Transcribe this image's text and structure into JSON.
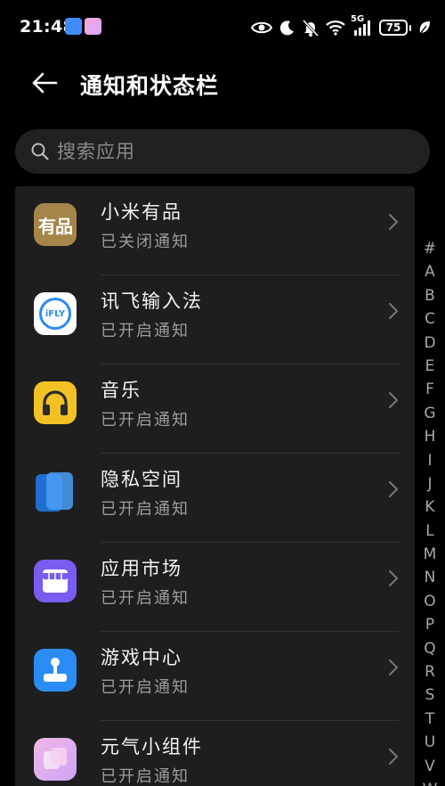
{
  "status_bar": {
    "time": "21:48",
    "network": "5G",
    "battery": "75"
  },
  "header": {
    "title": "通知和状态栏"
  },
  "search": {
    "placeholder": "搜索应用"
  },
  "apps": [
    {
      "name": "小米有品",
      "status": "已关闭通知",
      "icon": "youpin-icon",
      "icon_text": "有品",
      "color": "#a6854b"
    },
    {
      "name": "讯飞输入法",
      "status": "已开启通知",
      "icon": "ifly-icon",
      "icon_text": "iFLY",
      "color": "#ffffff"
    },
    {
      "name": "音乐",
      "status": "已开启通知",
      "icon": "headphones-icon",
      "color": "#f2c224"
    },
    {
      "name": "隐私空间",
      "status": "已开启通知",
      "icon": "private-space-icon",
      "color": "#2a7fe0"
    },
    {
      "name": "应用市场",
      "status": "已开启通知",
      "icon": "store-icon",
      "color": "#7a5cf0"
    },
    {
      "name": "游戏中心",
      "status": "已开启通知",
      "icon": "joystick-icon",
      "color": "#2b8cf5"
    },
    {
      "name": "元气小组件",
      "status": "已开启通知",
      "icon": "widget-icon",
      "color": "#e9a6e8"
    }
  ],
  "alphabet": [
    "#",
    "A",
    "B",
    "C",
    "D",
    "E",
    "F",
    "G",
    "H",
    "I",
    "J",
    "K",
    "L",
    "M",
    "N",
    "O",
    "P",
    "Q",
    "R",
    "S",
    "T",
    "U",
    "V",
    "W"
  ]
}
